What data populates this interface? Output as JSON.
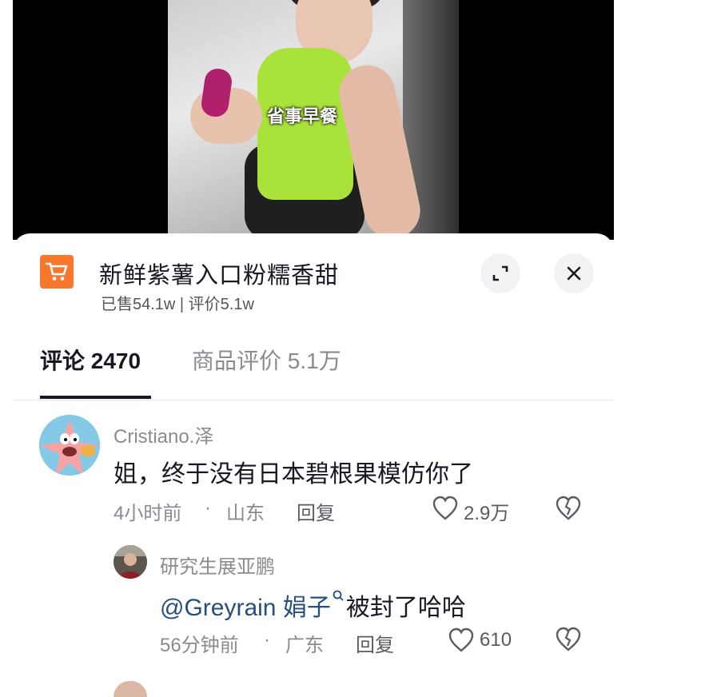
{
  "video": {
    "subtitle": "省事早餐"
  },
  "product": {
    "title": "新鲜紫薯入口粉糯香甜",
    "sold_info": "已售54.1w | 评价5.1w"
  },
  "tabs": [
    {
      "label": "评论 2470"
    },
    {
      "label": "商品评价 5.1万"
    }
  ],
  "comments": [
    {
      "user": "Cristiano.泽",
      "text": "姐，终于没有日本碧根果模仿你了",
      "time": "4小时前",
      "sep": "·",
      "location": "山东",
      "reply_label": "回复",
      "likes": "2.9万"
    },
    {
      "user": "研究生展亚鹏",
      "mention": "@Greyrain 娟子",
      "text": "被封了哈哈",
      "time": "56分钟前",
      "sep": "·",
      "location": "广东",
      "reply_label": "回复",
      "likes": "610"
    }
  ],
  "colors": {
    "accent_orange": "#f7782d",
    "text_dark": "#161823",
    "mention_blue": "#254f7d"
  }
}
